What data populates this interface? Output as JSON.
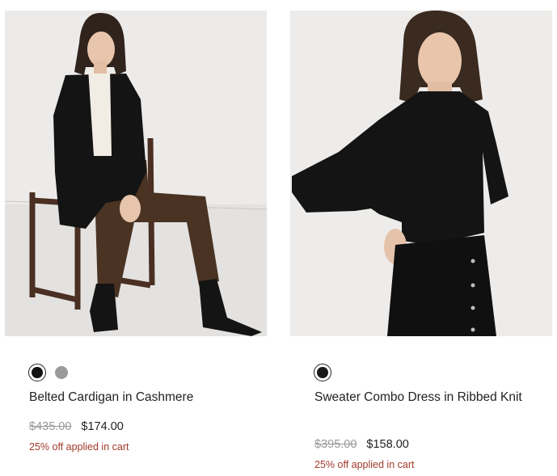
{
  "products": [
    {
      "name": "Belted Cardigan in Cashmere",
      "original_price": "$435.00",
      "sale_price": "$174.00",
      "promo": "25% off applied in cart",
      "swatches": [
        {
          "color": "#111111",
          "selected": true
        },
        {
          "color": "#9a9a9a",
          "selected": false
        }
      ]
    },
    {
      "name": "Sweater Combo Dress in Ribbed Knit",
      "original_price": "$395.00",
      "sale_price": "$158.00",
      "promo": "25% off applied in cart",
      "swatches": [
        {
          "color": "#1a1a1a",
          "selected": true
        }
      ]
    }
  ]
}
